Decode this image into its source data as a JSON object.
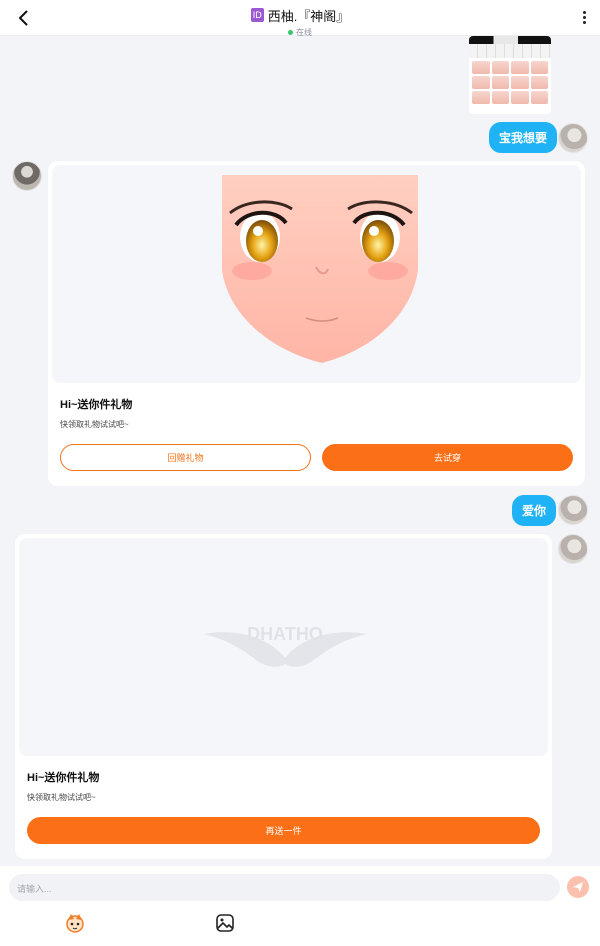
{
  "header": {
    "id_badge": "ID",
    "title": "西柚.『神阁』",
    "status": "在线"
  },
  "messages": {
    "sent_1": "宝我想要",
    "sent_2": "爱你"
  },
  "gift_card_1": {
    "title": "Hi~送你件礼物",
    "subtitle": "快领取礼物试试吧~",
    "return_button": "回赠礼物",
    "try_button": "去试穿"
  },
  "gift_card_2": {
    "title": "Hi~送你件礼物",
    "subtitle": "快领取礼物试试吧~",
    "send_again_button": "再送一件",
    "watermark": "DHATHO"
  },
  "composer": {
    "placeholder": "请输入..."
  },
  "colors": {
    "accent_orange": "#fb6f16",
    "bubble_blue": "#1fb3f5",
    "online_green": "#3ac36d",
    "id_purple": "#9b59d0"
  },
  "icons": [
    "back-arrow-icon",
    "more-vertical-icon",
    "send-icon",
    "mascot-icon",
    "image-icon"
  ]
}
